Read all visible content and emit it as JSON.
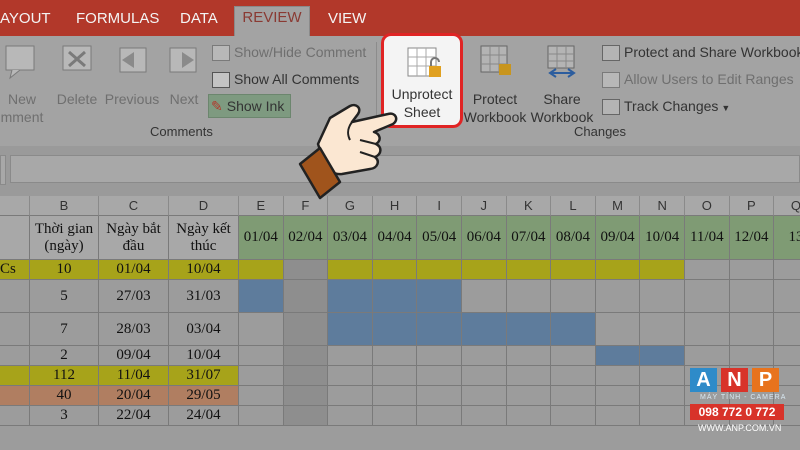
{
  "tabs": [
    {
      "label": "AYOUT",
      "active": false
    },
    {
      "label": "FORMULAS",
      "active": false
    },
    {
      "label": "DATA",
      "active": false
    },
    {
      "label": "REVIEW",
      "active": true
    },
    {
      "label": "VIEW",
      "active": false
    }
  ],
  "ribbon": {
    "comments_group": {
      "label": "Comments",
      "new_comment_line1": "New",
      "new_comment_line2": "mment",
      "delete": "Delete",
      "previous": "Previous",
      "next": "Next",
      "show_hide_comment": "Show/Hide Comment",
      "show_all_comments": "Show All Comments",
      "show_ink": "Show Ink"
    },
    "changes_group": {
      "label": "Changes",
      "unprotect_line1": "Unprotect",
      "unprotect_line2": "Sheet",
      "protect_wb_line1": "Protect",
      "protect_wb_line2": "Workbook",
      "share_wb_line1": "Share",
      "share_wb_line2": "Workbook",
      "protect_share": "Protect and Share Workbook",
      "allow_users": "Allow Users to Edit Ranges",
      "track_changes": "Track Changes"
    }
  },
  "sheet": {
    "col_letters": [
      "B",
      "C",
      "D",
      "E",
      "F",
      "G",
      "H",
      "I",
      "J",
      "K",
      "L",
      "M",
      "N",
      "O",
      "P",
      "Q"
    ],
    "headers": {
      "duration_line1": "Thời gian",
      "duration_line2": "(ngày)",
      "start_line1": "Ngày bắt",
      "start_line2": "đầu",
      "end_line1": "Ngày kết",
      "end_line2": "thúc"
    },
    "dates": [
      "01/04",
      "02/04",
      "03/04",
      "04/04",
      "05/04",
      "06/04",
      "07/04",
      "08/04",
      "09/04",
      "10/04",
      "11/04",
      "12/04",
      "13"
    ],
    "row_a_fragment": "Cs",
    "rows": [
      {
        "duration": "10",
        "start": "01/04",
        "end": "10/04"
      },
      {
        "duration": "5",
        "start": "27/03",
        "end": "31/03"
      },
      {
        "duration": "7",
        "start": "28/03",
        "end": "03/04"
      },
      {
        "duration": "2",
        "start": "09/04",
        "end": "10/04"
      },
      {
        "duration": "112",
        "start": "11/04",
        "end": "31/07"
      },
      {
        "duration": "40",
        "start": "20/04",
        "end": "29/05"
      },
      {
        "duration": "3",
        "start": "22/04",
        "end": "24/04"
      }
    ]
  },
  "watermark": {
    "letters": [
      "A",
      "N",
      "P"
    ],
    "tagline": "MÁY TÍNH - CAMERA",
    "phone": "098 772 0 772",
    "url": "WWW.ANP.COM.VN"
  },
  "colors": {
    "accent_red": "#e02424",
    "gantt_blue": "#5e7c9c",
    "row_yellow": "#a7a31a",
    "row_orange": "#b07e61",
    "date_header_green": "#7f9b74"
  }
}
